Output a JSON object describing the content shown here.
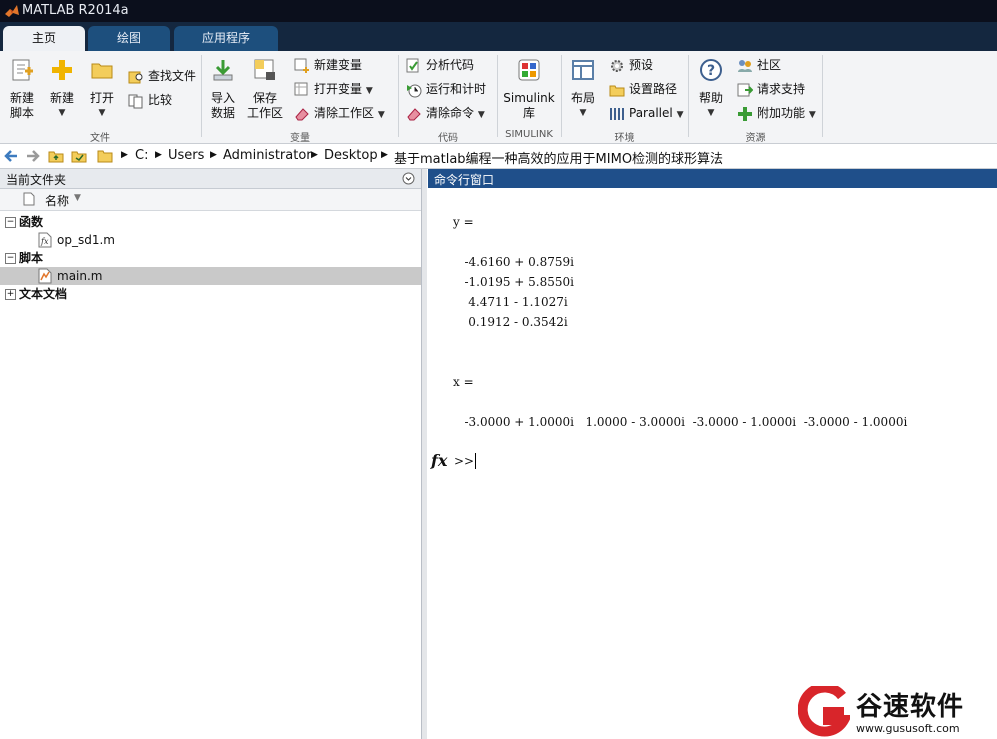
{
  "window": {
    "title": "MATLAB R2014a"
  },
  "tabs": [
    {
      "label": "主页"
    },
    {
      "label": "绘图"
    },
    {
      "label": "应用程序"
    }
  ],
  "ribbon": {
    "file": {
      "group_label": "文件",
      "new_script": [
        "新建",
        "脚本"
      ],
      "new": "新建",
      "open": "打开",
      "find_files": "查找文件",
      "compare": "比较"
    },
    "variable": {
      "group_label": "变量",
      "import_data": [
        "导入",
        "数据"
      ],
      "save_workspace": [
        "保存",
        "工作区"
      ],
      "new_variable": "新建变量",
      "open_variable": "打开变量",
      "clear_workspace": "清除工作区"
    },
    "code": {
      "group_label": "代码",
      "analyze_code": "分析代码",
      "run_and_time": "运行和计时",
      "clear_commands": "清除命令"
    },
    "simulink": {
      "group_label": "SIMULINK",
      "library": [
        "Simulink",
        "库"
      ]
    },
    "environment": {
      "group_label": "环境",
      "layout": "布局",
      "preferences": "预设",
      "set_path": "设置路径",
      "parallel": "Parallel"
    },
    "resources": {
      "group_label": "资源",
      "help": "帮助",
      "community": "社区",
      "request_support": "请求支持",
      "add_ons": "附加功能"
    }
  },
  "address": {
    "crumbs": [
      "C:",
      "Users",
      "Administrator",
      "Desktop",
      "基于matlab编程一种高效的应用于MIMO检测的球形算法"
    ]
  },
  "current_folder": {
    "title": "当前文件夹",
    "column_name": "名称",
    "groups": [
      {
        "label": "函数",
        "files": [
          "op_sd1.m"
        ]
      },
      {
        "label": "脚本",
        "files": [
          "main.m"
        ]
      },
      {
        "label": "文本文档",
        "files": []
      }
    ]
  },
  "command_window": {
    "title": "命令行窗口",
    "lines": [
      "y =",
      "   -4.6160 + 0.8759i",
      "   -1.0195 + 5.8550i",
      "    4.4711 - 1.1027i",
      "    0.1912 - 0.3542i",
      "x =",
      "   -3.0000 + 1.0000i   1.0000 - 3.0000i  -3.0000 - 1.0000i  -3.0000 - 1.0000i"
    ],
    "prompt": ">>",
    "fx_label": "fx"
  },
  "watermark": {
    "text": "谷速软件",
    "url": "www.gususoft.com"
  },
  "colors": {
    "title_bar": "#0b0f1c",
    "tab_bar": "#14273f",
    "tab": "#1d4f7d",
    "command_header": "#1f4f8a",
    "selection": "#c9c9c9",
    "watermark_red": "#d8252a"
  }
}
